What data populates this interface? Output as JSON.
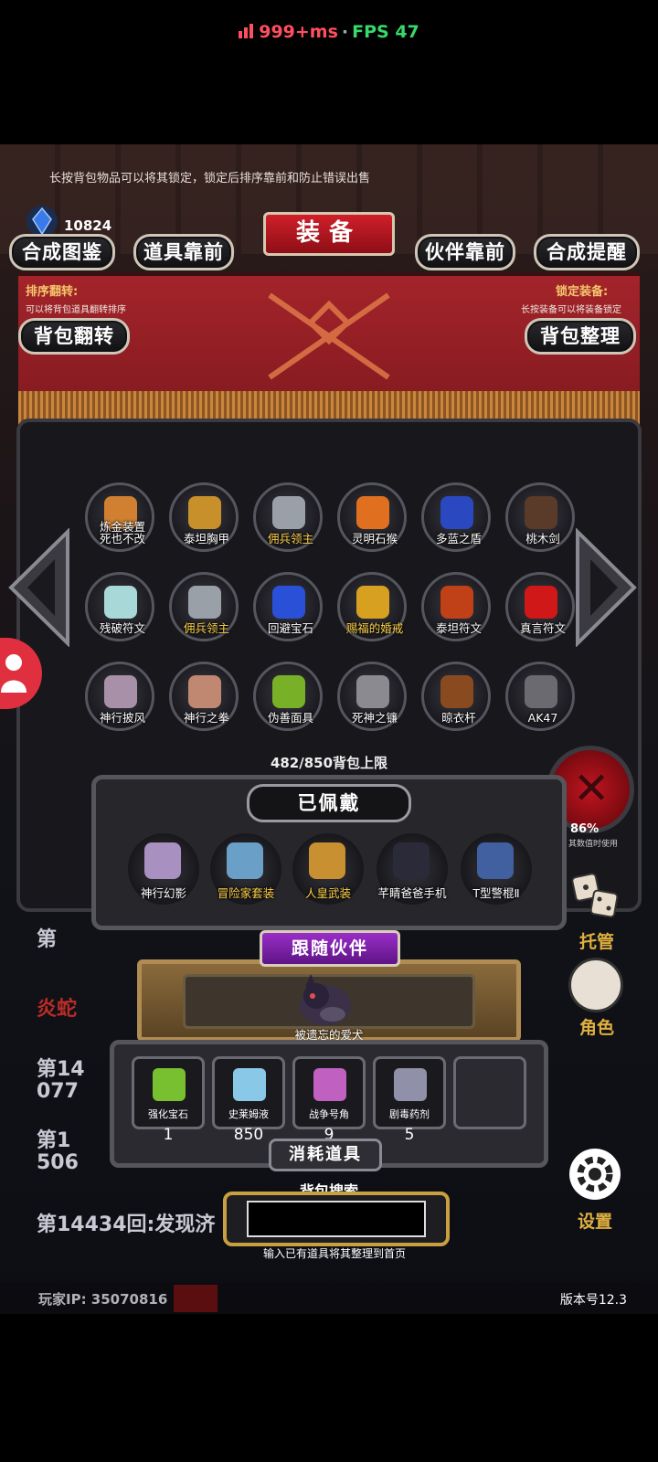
{
  "status": {
    "ping": "999+ms",
    "separator": "·",
    "fps": "FPS 47"
  },
  "tip": "长按背包物品可以将其锁定，锁定后排序靠前和防止错误出售",
  "currency": {
    "gem_count": "10824"
  },
  "header": {
    "title": "装备"
  },
  "buttons": {
    "synth_guide": "合成图鉴",
    "items_first": "道具靠前",
    "partner_first": "伙伴靠前",
    "synth_remind": "合成提醒",
    "bag_flip": "背包翻转",
    "bag_sort": "背包整理"
  },
  "hints": {
    "flip_title": "排序翻转:",
    "flip_sub": "可以将背包道具翻转排序",
    "lock_title": "锁定装备:",
    "lock_sub": "长按装备可以将装备锁定"
  },
  "inventory": [
    {
      "label": "炼金装置\n死也不改",
      "highlight": false,
      "color": "#d08030"
    },
    {
      "label": "泰坦胸甲",
      "highlight": false,
      "color": "#c8902a"
    },
    {
      "label": "佣兵领主",
      "highlight": true,
      "color": "#9aa0a8"
    },
    {
      "label": "灵明石猴",
      "highlight": false,
      "color": "#e07020"
    },
    {
      "label": "多蓝之盾",
      "highlight": false,
      "color": "#2a48c0"
    },
    {
      "label": "桃木剑",
      "highlight": false,
      "color": "#5a3a28"
    },
    {
      "label": "残破符文",
      "highlight": false,
      "color": "#a8d8d8"
    },
    {
      "label": "佣兵领主",
      "highlight": true,
      "color": "#9aa0a8"
    },
    {
      "label": "回避宝石",
      "highlight": false,
      "color": "#2a50d8"
    },
    {
      "label": "赐福的婚戒",
      "highlight": true,
      "color": "#d8a020"
    },
    {
      "label": "泰坦符文",
      "highlight": false,
      "color": "#c04018"
    },
    {
      "label": "真言符文",
      "highlight": false,
      "color": "#d01818"
    },
    {
      "label": "神行披风",
      "highlight": false,
      "color": "#a890a8"
    },
    {
      "label": "神行之拳",
      "highlight": false,
      "color": "#c08870"
    },
    {
      "label": "伪善面具",
      "highlight": false,
      "color": "#78b028"
    },
    {
      "label": "死神之镰",
      "highlight": false,
      "color": "#8a8a90"
    },
    {
      "label": "晾衣杆",
      "highlight": false,
      "color": "#8a4a20"
    },
    {
      "label": "AK47",
      "highlight": false,
      "color": "#6a6a70"
    }
  ],
  "capacity": "482/850背包上限",
  "equipped": {
    "title": "已佩戴",
    "items": [
      {
        "label": "神行幻影",
        "highlight": false,
        "color": "#a890c0"
      },
      {
        "label": "冒险家套装",
        "highlight": true,
        "color": "#6aa0c8"
      },
      {
        "label": "人皇武装",
        "highlight": true,
        "color": "#c89030"
      },
      {
        "label": "芊睛爸爸手机",
        "highlight": false,
        "color": "#2a2a38"
      },
      {
        "label": "T型警棍Ⅱ",
        "highlight": false,
        "color": "#4060a0"
      }
    ]
  },
  "companion": {
    "title": "跟随伙伴",
    "name": "被遗忘的爱犬"
  },
  "consumables": {
    "title": "消耗道具",
    "items": [
      {
        "label": "强化宝石",
        "qty": "1",
        "color": "#78c030"
      },
      {
        "label": "史莱姆液",
        "qty": "850",
        "color": "#8ac8e8"
      },
      {
        "label": "战争号角",
        "qty": "9",
        "color": "#c060c0"
      },
      {
        "label": "剧毒药剂",
        "qty": "5",
        "color": "#9090a8"
      },
      {
        "label": "",
        "qty": "",
        "color": "#2a2a30"
      }
    ]
  },
  "search": {
    "label": "背包搜索",
    "value": "",
    "hint": "输入已有道具将其整理到首页"
  },
  "log": {
    "line1": "第",
    "line2": "炎蛇",
    "line3": "第14",
    "line4": "077",
    "line5": "第1",
    "line6": "506",
    "line7": "第14434回:发现济"
  },
  "side": {
    "pct": "86%",
    "pct_sub": "其数值时使用",
    "manage": "托管",
    "role": "角色",
    "settings": "设置"
  },
  "footer": {
    "player_ip": "玩家IP:  35070816",
    "version": "版本号12.3"
  }
}
